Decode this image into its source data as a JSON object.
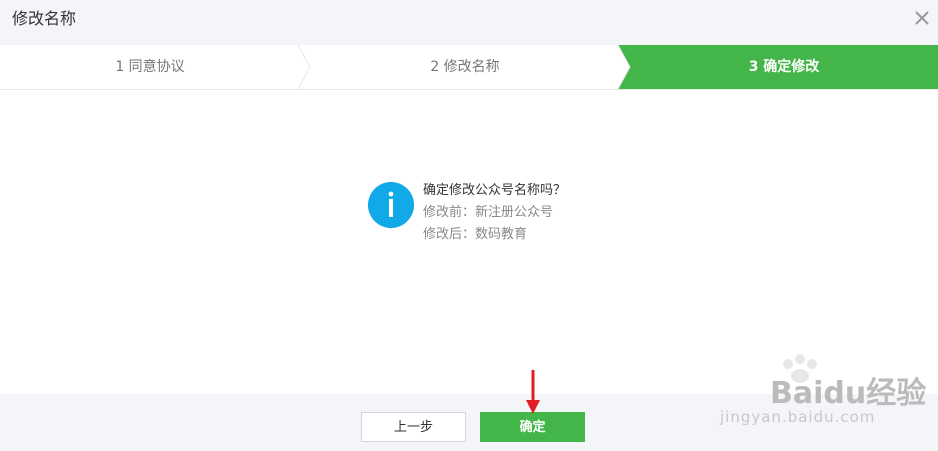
{
  "dialog": {
    "title": "修改名称",
    "close_icon": "close-icon"
  },
  "steps": [
    {
      "label": "1 同意协议",
      "active": false
    },
    {
      "label": "2 修改名称",
      "active": false
    },
    {
      "label": "3 确定修改",
      "active": true
    }
  ],
  "message": {
    "icon": "info-icon",
    "question": "确定修改公众号名称吗？",
    "before": "修改前：新注册公众号",
    "after": "修改后：数码教育"
  },
  "buttons": {
    "prev_label": "上一步",
    "confirm_label": "确定"
  },
  "colors": {
    "accent_green": "#44b549",
    "info_blue": "#12a9e8",
    "annotation_red": "#e01e24"
  },
  "watermark": {
    "brand": "Baidu经验",
    "url": "jingyan.baidu.com"
  }
}
